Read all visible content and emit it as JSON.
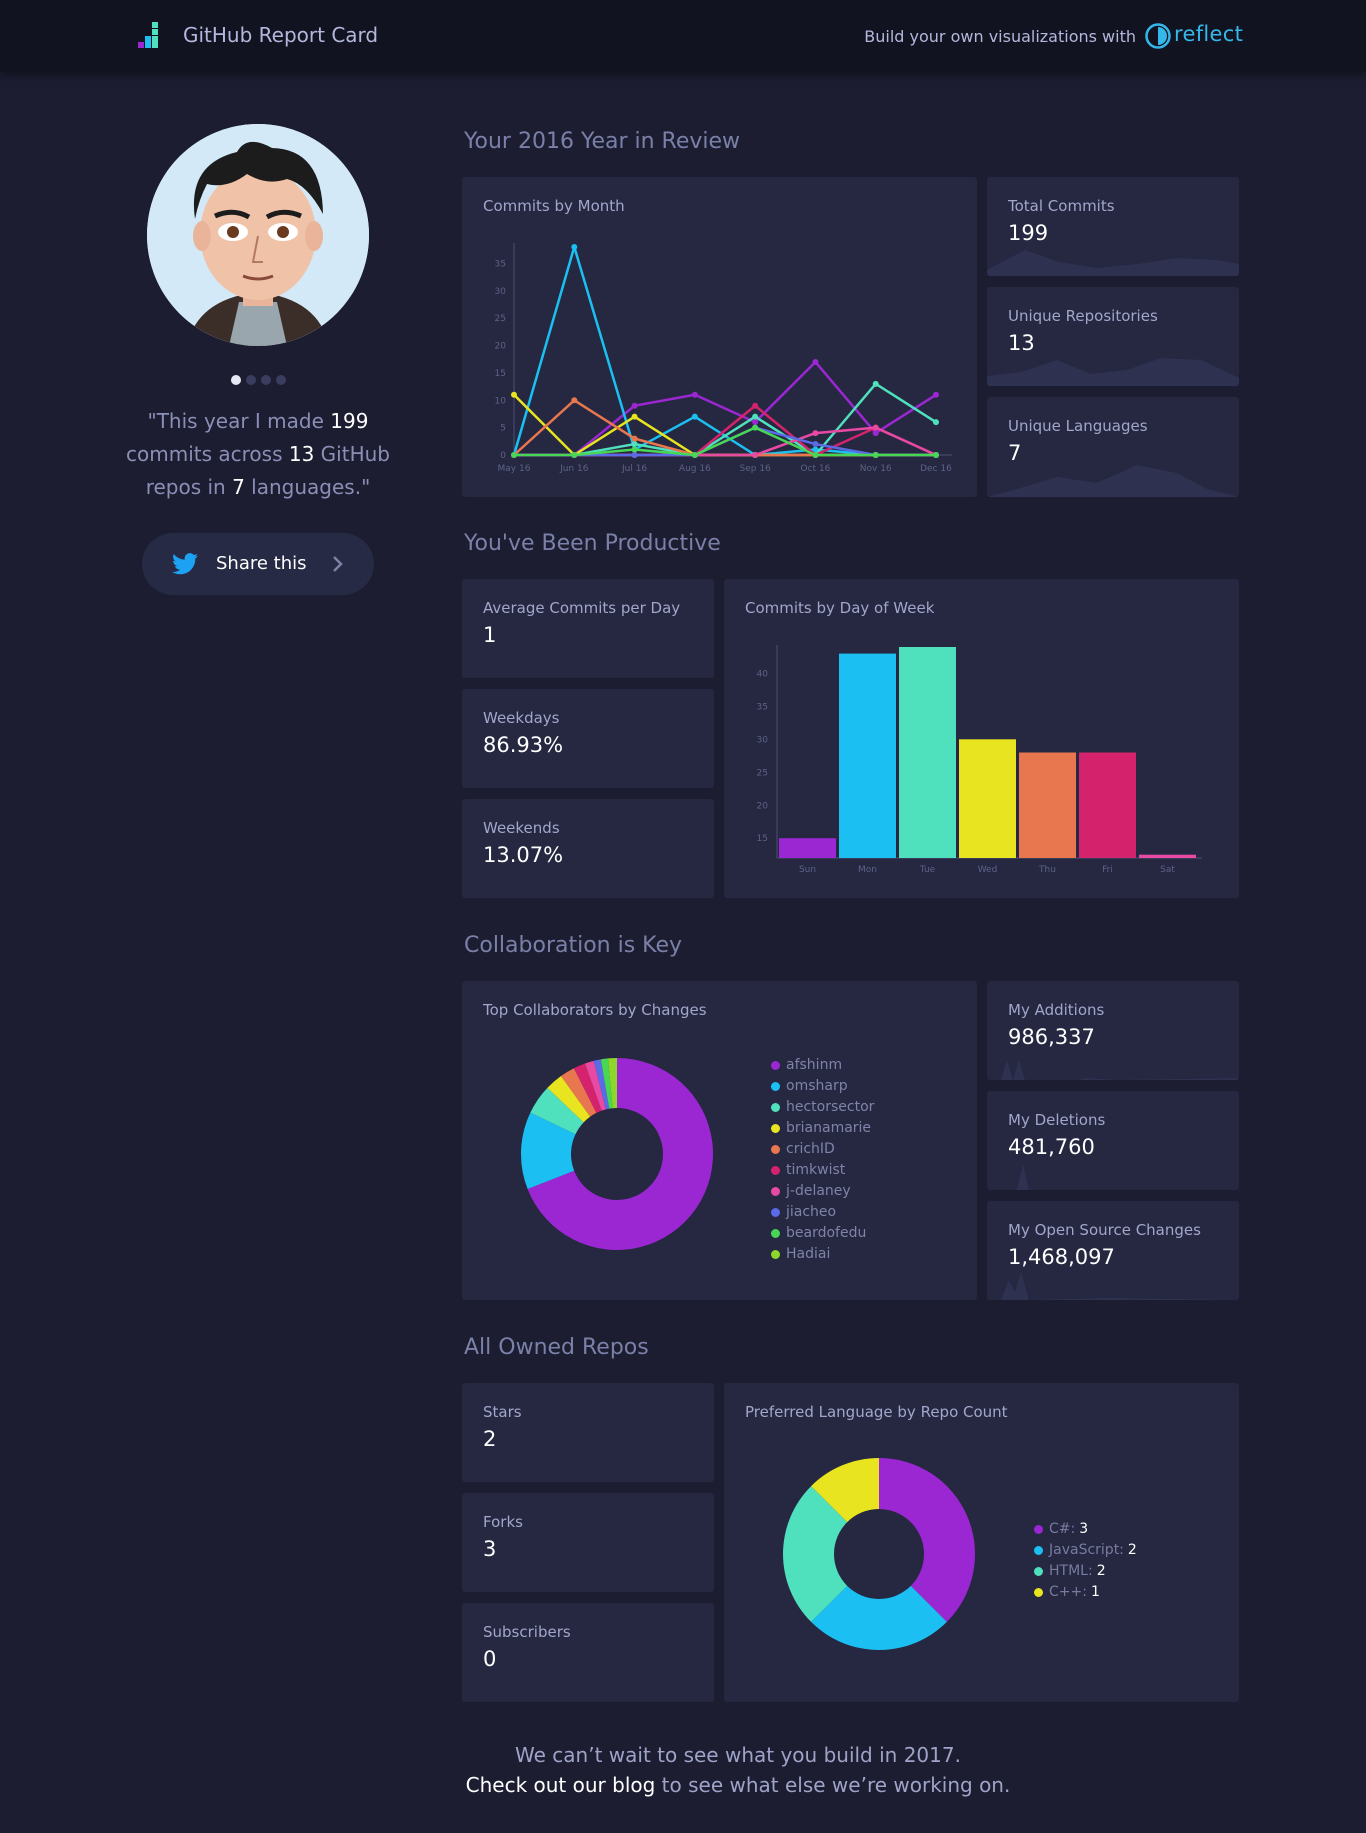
{
  "header": {
    "app_title": "GitHub Report Card",
    "build_text": "Build your own visualizations with",
    "reflect_name": "reflect",
    "accent": "#35b7ea"
  },
  "profile": {
    "quote": {
      "pre": "\"This year I made ",
      "commits": "199",
      "mid1": " commits across ",
      "repos": "13",
      "mid2": " GitHub repos in ",
      "langs": "7",
      "post": " languages.\""
    },
    "share_label": "Share this",
    "carousel_count": 4,
    "carousel_active": 0
  },
  "sections": {
    "review": "Your 2016 Year in Review",
    "productive": "You've Been Productive",
    "collab": "Collaboration is Key",
    "repos": "All Owned Repos"
  },
  "stats": {
    "total_commits": {
      "title": "Total Commits",
      "value": "199"
    },
    "unique_repos": {
      "title": "Unique Repositories",
      "value": "13"
    },
    "unique_langs": {
      "title": "Unique Languages",
      "value": "7"
    },
    "avg_commits": {
      "title": "Average Commits per Day",
      "value": "1"
    },
    "weekdays": {
      "title": "Weekdays",
      "value": "86.93%"
    },
    "weekends": {
      "title": "Weekends",
      "value": "13.07%"
    },
    "additions": {
      "title": "My Additions",
      "value": "986,337"
    },
    "deletions": {
      "title": "My Deletions",
      "value": "481,760"
    },
    "oss_changes": {
      "title": "My Open Source Changes",
      "value": "1,468,097"
    },
    "stars": {
      "title": "Stars",
      "value": "2"
    },
    "forks": {
      "title": "Forks",
      "value": "3"
    },
    "subscribers": {
      "title": "Subscribers",
      "value": "0"
    }
  },
  "chart_data": [
    {
      "id": "commits_by_month",
      "type": "line",
      "title": "Commits by Month",
      "x": [
        "May 16",
        "Jun 16",
        "Jul 16",
        "Aug 16",
        "Sep 16",
        "Oct 16",
        "Nov 16",
        "Dec 16"
      ],
      "ylim": [
        0,
        38
      ],
      "yticks": [
        0,
        5,
        10,
        15,
        20,
        25,
        30,
        35
      ],
      "series": [
        {
          "color": "#9b27d3",
          "values": [
            0,
            0,
            9,
            11,
            6,
            17,
            4,
            11
          ]
        },
        {
          "color": "#1cbff2",
          "values": [
            0,
            38,
            1,
            7,
            0,
            1,
            0,
            0
          ]
        },
        {
          "color": "#4fe0be",
          "values": [
            0,
            0,
            2,
            0,
            7,
            0,
            13,
            6
          ]
        },
        {
          "color": "#e8e41f",
          "values": [
            11,
            0,
            7,
            0,
            0,
            0,
            0,
            0
          ]
        },
        {
          "color": "#e8764f",
          "values": [
            0,
            10,
            3,
            0,
            0,
            0,
            0,
            0
          ]
        },
        {
          "color": "#d4236c",
          "values": [
            0,
            0,
            0,
            0,
            9,
            0,
            5,
            0
          ]
        },
        {
          "color": "#e84aa3",
          "values": [
            0,
            0,
            0,
            0,
            0,
            4,
            5,
            0
          ]
        },
        {
          "color": "#5b6ae6",
          "values": [
            0,
            0,
            0,
            0,
            5,
            2,
            0,
            0
          ]
        },
        {
          "color": "#48d655",
          "values": [
            0,
            0,
            1,
            0,
            5,
            0,
            0,
            0
          ]
        }
      ]
    },
    {
      "id": "commits_by_day",
      "type": "bar",
      "title": "Commits by Day of Week",
      "categories": [
        "Sun",
        "Mon",
        "Tue",
        "Wed",
        "Thu",
        "Fri",
        "Sat"
      ],
      "values": [
        15,
        43,
        44,
        30,
        28,
        28,
        12.5
      ],
      "colors": [
        "#9b27d3",
        "#1cbff2",
        "#4fe0be",
        "#e8e41f",
        "#e8764f",
        "#d4236c",
        "#e84aa3"
      ],
      "ylim": [
        12,
        44
      ],
      "yticks": [
        15,
        20,
        25,
        30,
        35,
        40
      ]
    },
    {
      "id": "top_collaborators",
      "type": "pie",
      "title": "Top Collaborators by Changes",
      "labels": [
        "afshinm",
        "omsharp",
        "hectorsector",
        "brianamarie",
        "crichID",
        "timkwist",
        "j-delaney",
        "jiacheo",
        "beardofedu",
        "Hadiai"
      ],
      "values": [
        69,
        13,
        5,
        3,
        2.5,
        2,
        1.5,
        1.2,
        1.2,
        1.5
      ],
      "colors": [
        "#9b27d3",
        "#1cbff2",
        "#4fe0be",
        "#e8e41f",
        "#e8764f",
        "#d4236c",
        "#e84aa3",
        "#5b6ae6",
        "#48d655",
        "#8dd62a"
      ]
    },
    {
      "id": "preferred_language",
      "type": "pie",
      "title": "Preferred Language by Repo Count",
      "labels": [
        "C#",
        "JavaScript",
        "HTML",
        "C++"
      ],
      "values": [
        3,
        2,
        2,
        1
      ],
      "colors": [
        "#9b27d3",
        "#1cbff2",
        "#4fe0be",
        "#e8e41f"
      ]
    }
  ],
  "footer": {
    "line1": "We can’t wait to see what you build in 2017.",
    "link_text": "Check out our blog",
    "line2_rest": " to see what else we’re working on."
  }
}
